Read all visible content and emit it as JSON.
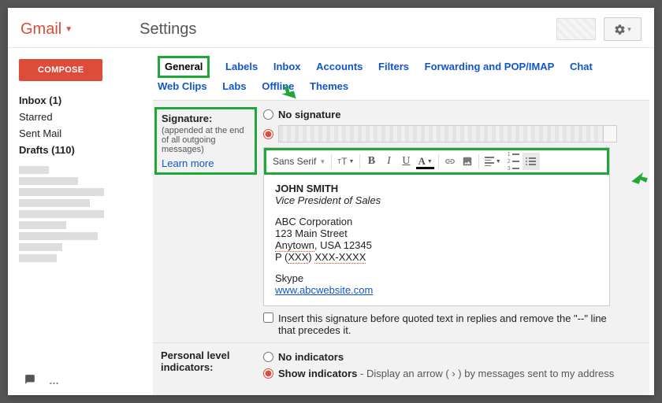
{
  "header": {
    "logo": "Gmail",
    "title": "Settings"
  },
  "compose": "COMPOSE",
  "nav": {
    "inbox": "Inbox (1)",
    "starred": "Starred",
    "sent": "Sent Mail",
    "drafts": "Drafts (110)"
  },
  "tabs": {
    "general": "General",
    "labels": "Labels",
    "inbox": "Inbox",
    "accounts": "Accounts",
    "filters": "Filters",
    "fwd": "Forwarding and POP/IMAP",
    "chat": "Chat",
    "webclips": "Web Clips",
    "labs": "Labs",
    "offline": "Offline",
    "themes": "Themes"
  },
  "signature": {
    "label": "Signature:",
    "sub": "(appended at the end of all outgoing messages)",
    "learn": "Learn more",
    "no_sig": "No signature",
    "font": "Sans Serif",
    "body": {
      "name": "JOHN SMITH",
      "role": "Vice President of Sales",
      "company": "ABC Corporation",
      "street": "123 Main Street",
      "city_pre": "Anytown",
      "city_post": ", USA 12345",
      "phone_pre": "P (",
      "phone_mid": "XXX",
      "phone_mid2": ") ",
      "phone_end": "XXX-XXXX",
      "skype": "Skype",
      "url": "www.abcwebsite.com"
    },
    "insert_before": "Insert this signature before quoted text in replies and remove the \"--\" line that precedes it."
  },
  "indicators": {
    "label": "Personal level indicators:",
    "none": "No indicators",
    "show": "Show indicators",
    "show_desc": " - Display an arrow ( › ) by messages sent to my address"
  }
}
